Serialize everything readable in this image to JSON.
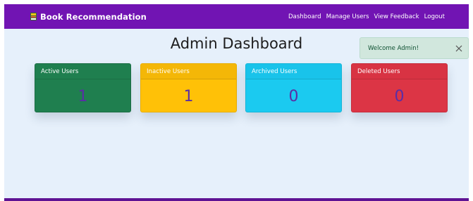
{
  "navbar": {
    "brand": "Book Recommendation",
    "links": [
      "Dashboard",
      "Manage Users",
      "View Feedback",
      "Logout"
    ]
  },
  "page": {
    "title": "Admin Dashboard"
  },
  "toast": {
    "message": "Welcome Admin!"
  },
  "cards": [
    {
      "label": "Active Users",
      "value": "1"
    },
    {
      "label": "Inactive Users",
      "value": "1"
    },
    {
      "label": "Archived Users",
      "value": "0"
    },
    {
      "label": "Deleted Users",
      "value": "0"
    }
  ],
  "colors": {
    "navbar": "#7114b3",
    "background": "#e6f0fb",
    "active": "#1f7f4f",
    "inactive": "#ffc107",
    "archived": "#1bcaf0",
    "deleted": "#dc3545",
    "value_text": "#5a2ea6"
  }
}
